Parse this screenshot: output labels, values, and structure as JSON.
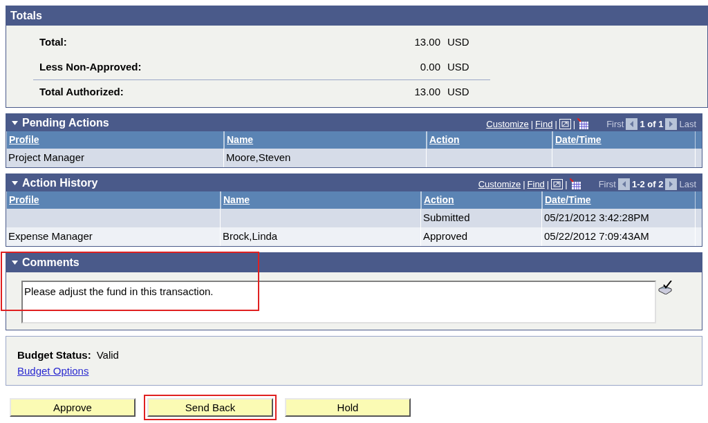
{
  "totals": {
    "title": "Totals",
    "rows": [
      {
        "label": "Total:",
        "amount": "13.00",
        "currency": "USD"
      },
      {
        "label": "Less Non-Approved:",
        "amount": "0.00",
        "currency": "USD"
      },
      {
        "label": "Total Authorized:",
        "amount": "13.00",
        "currency": "USD"
      }
    ]
  },
  "grids": [
    {
      "title": "Pending Actions",
      "toolbar": [
        {
          "kind": "link",
          "text": "Customize"
        },
        {
          "kind": "separator",
          "text": "|"
        },
        {
          "kind": "link",
          "text": "Find"
        },
        {
          "kind": "separator",
          "text": "|"
        },
        {
          "kind": "zoom"
        },
        {
          "kind": "separator",
          "text": "|"
        },
        {
          "kind": "download"
        }
      ],
      "first": "First",
      "count": "1 of 1",
      "last": "Last",
      "columns": [
        "Profile",
        "Name",
        "Action",
        "Date/Time"
      ],
      "rows": [
        [
          "Project Manager",
          "Moore,Steven",
          "",
          ""
        ]
      ]
    },
    {
      "title": "Action History",
      "toolbar": [
        {
          "kind": "link",
          "text": "Customize"
        },
        {
          "kind": "separator",
          "text": "|"
        },
        {
          "kind": "link",
          "text": "Find"
        },
        {
          "kind": "separator",
          "text": "|"
        },
        {
          "kind": "zoom"
        },
        {
          "kind": "separator",
          "text": "|"
        },
        {
          "kind": "download"
        }
      ],
      "first": "First",
      "count": "1-2 of 2",
      "last": "Last",
      "columns": [
        "Profile",
        "Name",
        "Action",
        "Date/Time"
      ],
      "rows": [
        [
          "",
          "",
          "Submitted",
          "05/21/2012  3:42:28PM"
        ],
        [
          "Expense Manager",
          "Brock,Linda",
          "Approved",
          "05/22/2012  7:09:43AM"
        ]
      ]
    }
  ],
  "comments": {
    "title": "Comments",
    "value": "Please adjust the fund in this transaction.",
    "highlighted": true
  },
  "budget": {
    "label": "Budget Status:",
    "value": "Valid",
    "link": "Budget Options"
  },
  "buttons": [
    {
      "label": "Approve",
      "highlighted": false
    },
    {
      "label": "Send Back",
      "highlighted": true
    },
    {
      "label": "Hold",
      "highlighted": false
    }
  ]
}
